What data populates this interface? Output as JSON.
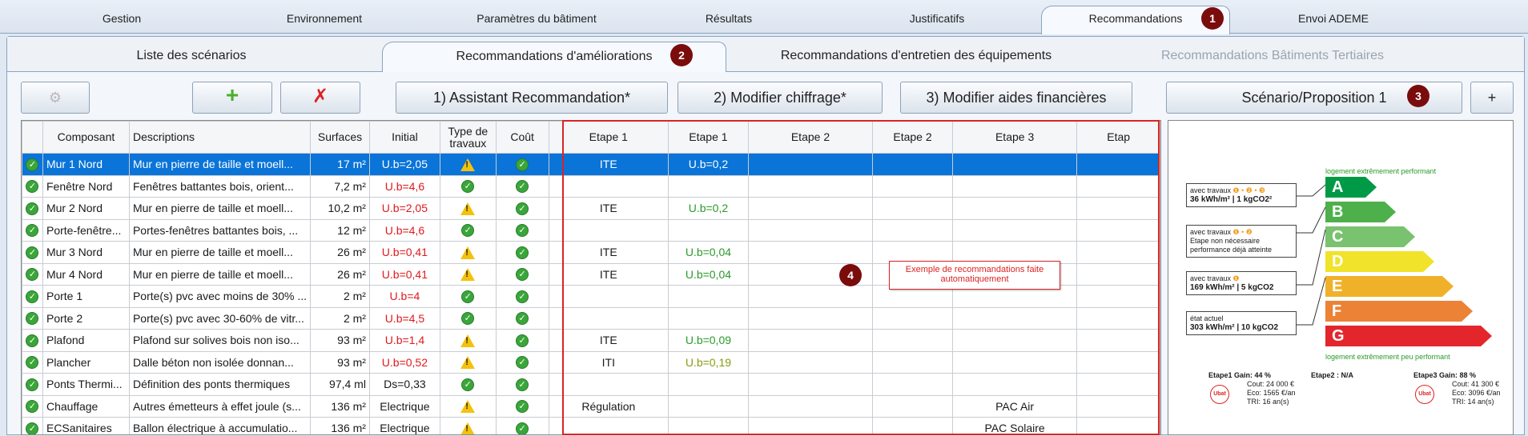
{
  "top_tabs": [
    "Gestion",
    "Environnement",
    "Paramètres du bâtiment",
    "Résultats",
    "Justificatifs",
    "Recommandations",
    "Envoi ADEME"
  ],
  "sub_tabs": [
    "Liste des scénarios",
    "Recommandations d'améliorations",
    "Recommandations d'entretien des équipements",
    "Recommandations Bâtiments Tertiaires"
  ],
  "badges": [
    "1",
    "2",
    "3",
    "4"
  ],
  "toolbar": {
    "assistant": "1) Assistant Recommandation*",
    "chiffrage": "2) Modifier chiffrage*",
    "aides": "3) Modifier aides financières",
    "scenario": "Scénario/Proposition 1",
    "plus": "+"
  },
  "table": {
    "headers": [
      "Composant",
      "Descriptions",
      "Surfaces",
      "Initial",
      "Type de travaux",
      "Coût",
      "Etape 1",
      "Etape 1",
      "Etape 2",
      "Etape 2",
      "Etape 3",
      "Etap"
    ],
    "rows": [
      {
        "comp": "Mur 1 Nord",
        "desc": "Mur en pierre de taille et moell...",
        "surf": "17 m²",
        "init": "U.b=2,05",
        "type": "warn",
        "e1": "ITE",
        "e1b": "U.b=0,2",
        "e3": ""
      },
      {
        "comp": "Fenêtre Nord",
        "desc": "Fenêtres battantes bois, orient...",
        "surf": "7,2 m²",
        "init": "U.b=4,6",
        "type": "ok",
        "e1": "",
        "e1b": "",
        "e3": ""
      },
      {
        "comp": "Mur 2 Nord",
        "desc": "Mur en pierre de taille et moell...",
        "surf": "10,2 m²",
        "init": "U.b=2,05",
        "type": "warn",
        "e1": "ITE",
        "e1b": "U.b=0,2",
        "e3": ""
      },
      {
        "comp": "Porte-fenêtre...",
        "desc": "Portes-fenêtres battantes bois, ...",
        "surf": "12 m²",
        "init": "U.b=4,6",
        "type": "ok",
        "e1": "",
        "e1b": "",
        "e3": ""
      },
      {
        "comp": "Mur 3 Nord",
        "desc": "Mur en pierre de taille et moell...",
        "surf": "26 m²",
        "init": "U.b=0,41",
        "type": "warn",
        "e1": "ITE",
        "e1b": "U.b=0,04",
        "e3": ""
      },
      {
        "comp": "Mur 4 Nord",
        "desc": "Mur en pierre de taille et moell...",
        "surf": "26 m²",
        "init": "U.b=0,41",
        "type": "warn",
        "e1": "ITE",
        "e1b": "U.b=0,04",
        "e3": ""
      },
      {
        "comp": "Porte 1",
        "desc": "Porte(s) pvc avec moins de 30% ...",
        "surf": "2 m²",
        "init": "U.b=4",
        "type": "ok",
        "e1": "",
        "e1b": "",
        "e3": ""
      },
      {
        "comp": "Porte 2",
        "desc": "Porte(s) pvc avec 30-60% de vitr...",
        "surf": "2 m²",
        "init": "U.b=4,5",
        "type": "ok",
        "e1": "",
        "e1b": "",
        "e3": ""
      },
      {
        "comp": "Plafond",
        "desc": "Plafond sur solives bois non iso...",
        "surf": "93 m²",
        "init": "U.b=1,4",
        "type": "warn",
        "e1": "ITE",
        "e1b": "U.b=0,09",
        "e3": ""
      },
      {
        "comp": "Plancher",
        "desc": "Dalle béton non isolée donnan...",
        "surf": "93 m²",
        "init": "U.b=0,52",
        "type": "warn",
        "e1": "ITI",
        "e1b": "U.b=0,19",
        "e3": ""
      },
      {
        "comp": "Ponts Thermi...",
        "desc": "Définition des ponts thermiques",
        "surf": "97,4 ml",
        "init": "Ds=0,33",
        "type": "ok",
        "e1": "",
        "e1b": "",
        "e3": ""
      },
      {
        "comp": "Chauffage",
        "desc": "Autres émetteurs à effet joule (s...",
        "surf": "136 m²",
        "init": "Electrique",
        "type": "warn",
        "e1": "Régulation",
        "e1b": "",
        "e3": "PAC Air"
      },
      {
        "comp": "ECSanitaires",
        "desc": "Ballon électrique à accumulatio...",
        "surf": "136 m²",
        "init": "Electrique",
        "type": "warn",
        "e1": "",
        "e1b": "",
        "e3": "PAC Solaire"
      }
    ]
  },
  "note": "Exemple de recommandations faite automatiquement",
  "dpe": {
    "top_caption": "logement extrêmement performant",
    "bottom_caption": "logement extrêmement peu performant",
    "letters": [
      "A",
      "B",
      "C",
      "D",
      "E",
      "F",
      "G"
    ],
    "colors": [
      "#009a47",
      "#4db04a",
      "#79c26f",
      "#f0e32a",
      "#f0b12a",
      "#ec8235",
      "#e3262c"
    ],
    "boxes": [
      {
        "line1": "avec travaux",
        "line2": "36 kWh/m² | 1 kgCO2²"
      },
      {
        "line1": "avec travaux",
        "line2": "Etape non nécessaire",
        "line3": "performance déjà atteinte"
      },
      {
        "line1": "avec travaux",
        "line2": "169 kWh/m² | 5 kgCO2"
      },
      {
        "line1": "état actuel",
        "line2": "303 kWh/m² | 10 kgCO2"
      }
    ],
    "etape1": {
      "title": "Etape1 Gain: 44 %",
      "cout": "Cout: 24 000 €",
      "eco": "Eco: 1565 €/an",
      "tri": "TRI: 16 an(s)"
    },
    "etape2": {
      "title": "Etape2 : N/A"
    },
    "etape3": {
      "title": "Etape3 Gain: 88 %",
      "cout": "Cout: 41 300 €",
      "eco": "Eco: 3096 €/an",
      "tri": "TRI: 14 an(s)"
    },
    "ubat": "Ubat"
  }
}
